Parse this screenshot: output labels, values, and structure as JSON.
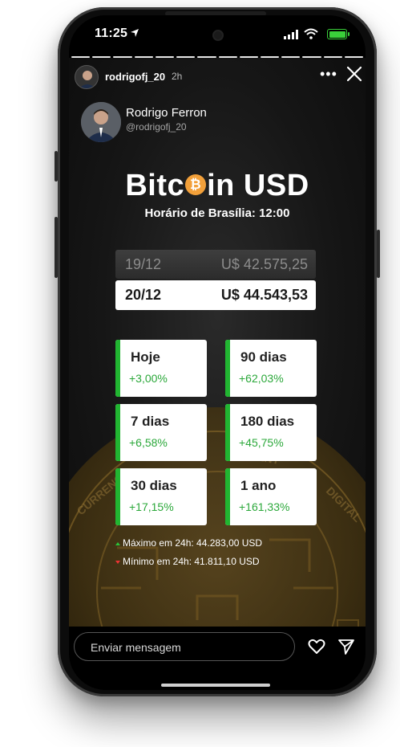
{
  "status_bar": {
    "time": "11:25"
  },
  "story": {
    "username": "rodrigofj_20",
    "time_ago": "2h",
    "progress_segments": 14
  },
  "profile": {
    "name": "Rodrigo Ferron",
    "handle": "@rodrigofj_20"
  },
  "headline": {
    "title_left": "Bitc",
    "title_right": "in USD",
    "coin_glyph": "₿",
    "subtitle": "Horário de Brasília: 12:00"
  },
  "prices": {
    "previous": {
      "date": "19/12",
      "value": "U$ 42.575,25"
    },
    "current": {
      "date": "20/12",
      "value": "U$ 44.543,53"
    }
  },
  "changes": [
    {
      "label": "Hoje",
      "value": "+3,00%"
    },
    {
      "label": "90 dias",
      "value": "+62,03%"
    },
    {
      "label": "7 dias",
      "value": "+6,58%"
    },
    {
      "label": "180 dias",
      "value": "+45,75%"
    },
    {
      "label": "30 dias",
      "value": "+17,15%"
    },
    {
      "label": "1 ano",
      "value": "+161,33%"
    }
  ],
  "stats": {
    "max": "Máximo em 24h: 44.283,00 USD",
    "min": "Mínimo em 24h: 41.811,10 USD"
  },
  "reply": {
    "placeholder": "Enviar mensagem"
  },
  "colors": {
    "accent_green": "#21b531",
    "positive_text": "#2ba83a",
    "bitcoin_orange": "#f2a03a",
    "negative": "#ee3333"
  },
  "icons": [
    "location-arrow-icon",
    "signal-icon",
    "wifi-icon",
    "battery-icon",
    "more-icon",
    "close-icon",
    "heart-icon",
    "send-icon"
  ]
}
